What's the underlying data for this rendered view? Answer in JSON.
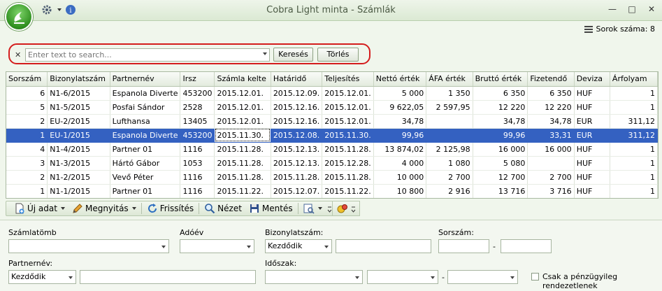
{
  "window": {
    "title": "Cobra Light minta - Számlák"
  },
  "row_count": {
    "label": "Sorok száma: 8"
  },
  "search": {
    "placeholder": "Enter text to search...",
    "search_button": "Keresés",
    "clear_button": "Törlés"
  },
  "grid": {
    "columns": [
      "Sorszám",
      "Bizonylatszám",
      "Partnernév",
      "Irsz",
      "Számla kelte",
      "Határidő",
      "Teljesítés",
      "Nettó érték",
      "ÁFA érték",
      "Bruttó érték",
      "Fizetendő",
      "Deviza",
      "Árfolyam"
    ],
    "rows": [
      [
        "6",
        "N1-6/2015",
        "Espanola Diverte",
        "453200",
        "2015.12.01.",
        "2015.12.09.",
        "2015.12.01.",
        "5 000",
        "1 350",
        "6 350",
        "6 350",
        "HUF",
        "1"
      ],
      [
        "5",
        "N1-5/2015",
        "Posfai Sándor",
        "2528",
        "2015.12.01.",
        "2015.12.16.",
        "2015.12.01.",
        "9 622,05",
        "2 597,95",
        "12 220",
        "12 220",
        "HUF",
        "1"
      ],
      [
        "2",
        "EU-2/2015",
        "Lufthansa",
        "13405",
        "2015.12.01.",
        "2015.12.16.",
        "2015.12.01.",
        "34,78",
        "",
        "34,78",
        "34,78",
        "EUR",
        "311,12"
      ],
      [
        "1",
        "EU-1/2015",
        "Espanola Diverte",
        "453200",
        "2015.11.30.",
        "2015.12.08.",
        "2015.11.30.",
        "99,96",
        "",
        "99,96",
        "33,31",
        "EUR",
        "311,12"
      ],
      [
        "4",
        "N1-4/2015",
        "Partner 01",
        "1116",
        "2015.11.28.",
        "2015.12.13.",
        "2015.11.28.",
        "13 874,02",
        "2 125,98",
        "16 000",
        "16 000",
        "HUF",
        "1"
      ],
      [
        "3",
        "N1-3/2015",
        "Hártó Gábor",
        "1053",
        "2015.11.28.",
        "2015.12.13.",
        "2015.12.28.",
        "4 000",
        "1 080",
        "5 080",
        "",
        "HUF",
        "1"
      ],
      [
        "2",
        "N1-2/2015",
        "Vevő Péter",
        "1116",
        "2015.11.28.",
        "2015.11.28.",
        "2015.11.28.",
        "10 000",
        "2 700",
        "12 700",
        "2 700",
        "HUF",
        "1"
      ],
      [
        "1",
        "N1-1/2015",
        "Partner 01",
        "1116",
        "2015.11.22.",
        "2015.12.07.",
        "2015.11.22.",
        "10 800",
        "2 916",
        "13 716",
        "3 716",
        "HUF",
        "1"
      ]
    ]
  },
  "toolbar": {
    "new": "Új adat",
    "open": "Megnyitás",
    "refresh": "Frissítés",
    "view": "Nézet",
    "save": "Mentés"
  },
  "filters": {
    "szamlatomb_label": "Számlatömb",
    "adoev_label": "Adóév",
    "bizonylatszam_label": "Bizonylatszám:",
    "bizonylatszam_mode": "Kezdődik",
    "sorszam_label": "Sorszám:",
    "partnernev_label": "Partnernév:",
    "partnernev_mode": "Kezdődik",
    "idoszak_label": "Időszak:",
    "checkbox_label": "Csak a pénzügyileg rendezetlenek"
  }
}
